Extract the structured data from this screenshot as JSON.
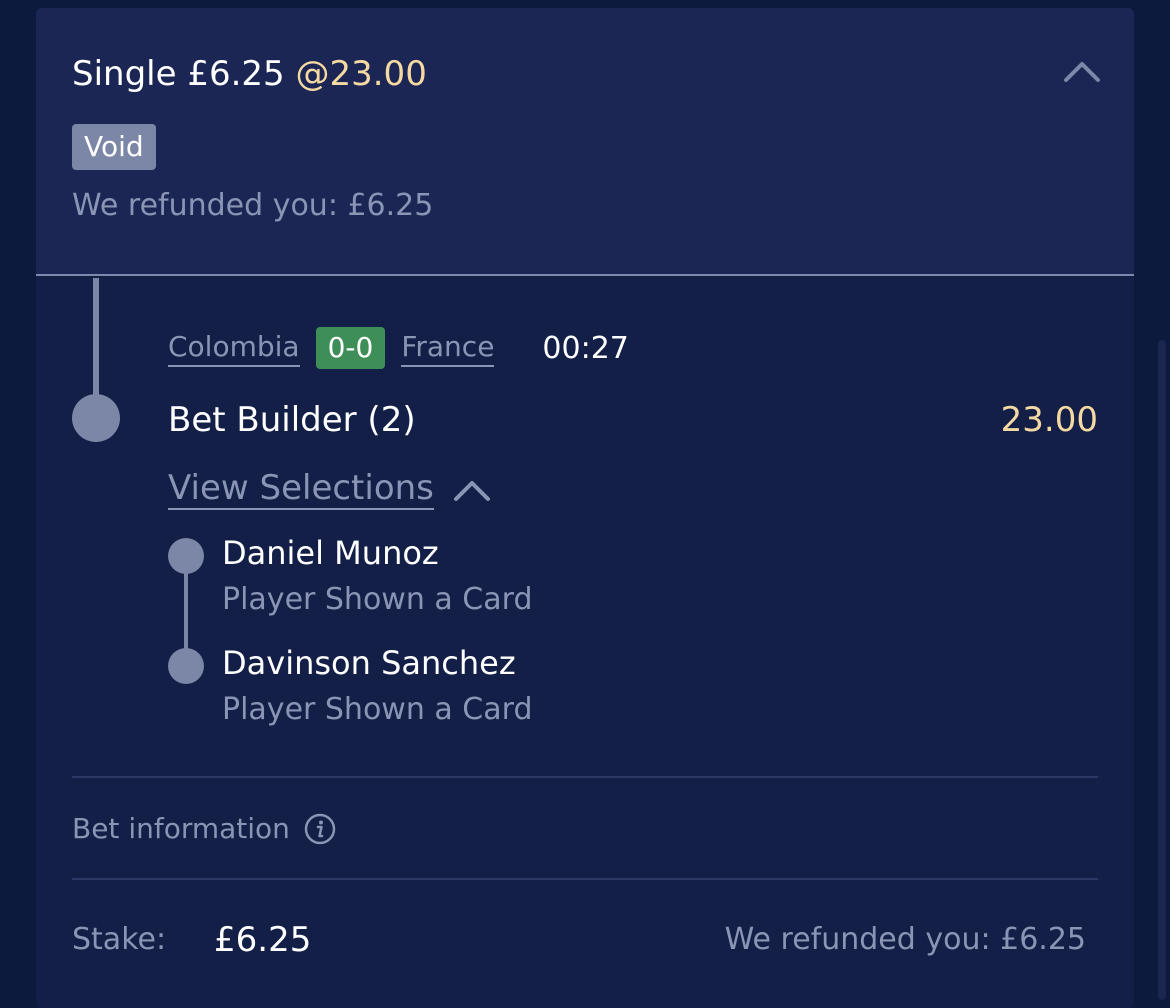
{
  "bet": {
    "title": "Single £6.25",
    "odds": "@23.00",
    "status": "Void",
    "refund_text": "We refunded you: £6.25"
  },
  "match": {
    "home": "Colombia",
    "score": "0-0",
    "away": "France",
    "clock": "00:27"
  },
  "market": {
    "name": "Bet Builder (2)",
    "odds": "23.00",
    "view_selections_label": "View Selections"
  },
  "selections": [
    {
      "name": "Daniel Munoz",
      "market": "Player Shown a Card"
    },
    {
      "name": "Davinson Sanchez",
      "market": "Player Shown a Card"
    }
  ],
  "footer": {
    "bet_info_label": "Bet information",
    "stake_label": "Stake:",
    "stake_value": "£6.25",
    "refund_text": "We refunded you: £6.25"
  },
  "icons": {
    "collapse": "chevron-up-icon",
    "view_selections": "chevron-up-icon",
    "info": "info-icon"
  },
  "colors": {
    "background": "#0c1a3e",
    "card_header": "#1c2654",
    "card_body": "#141f48",
    "odds": "#f4d9a3",
    "score_badge": "#3e8f57",
    "status_badge": "#7c86a6",
    "muted_text": "#8a94b4"
  }
}
